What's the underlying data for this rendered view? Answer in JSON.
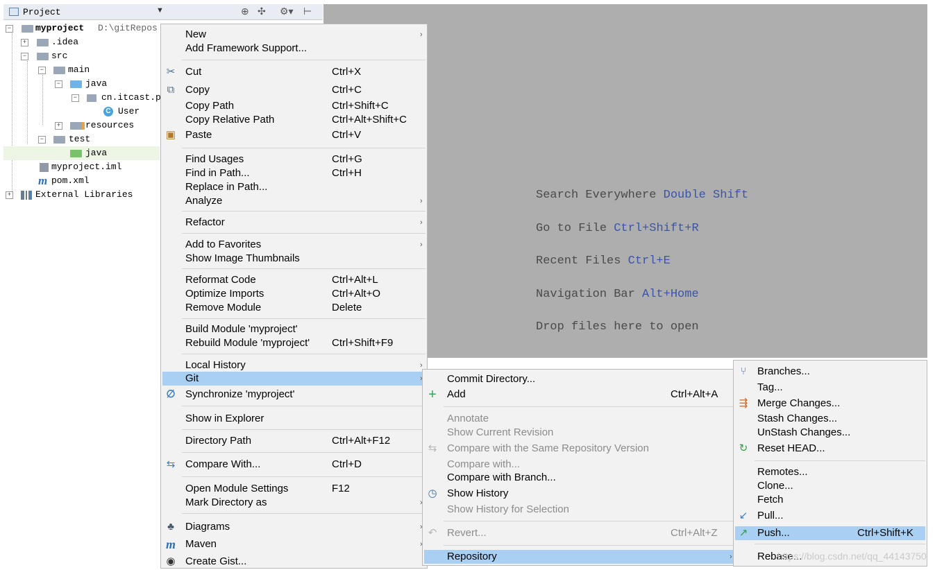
{
  "project_panel": {
    "title": "Project",
    "tree": [
      {
        "label": "myproject",
        "path": "D:\\gitRepos"
      },
      {
        "label": ".idea"
      },
      {
        "label": "src"
      },
      {
        "label": "main"
      },
      {
        "label": "java"
      },
      {
        "label": "cn.itcast.p"
      },
      {
        "label": "User"
      },
      {
        "label": "resources"
      },
      {
        "label": "test"
      },
      {
        "label": "java"
      },
      {
        "label": "myproject.iml"
      },
      {
        "label": "pom.xml"
      },
      {
        "label": "External Libraries"
      }
    ]
  },
  "editor_hints": [
    {
      "text": "Search Everywhere",
      "key": "Double Shift"
    },
    {
      "text": "Go to File",
      "key": "Ctrl+Shift+R"
    },
    {
      "text": "Recent Files",
      "key": "Ctrl+E"
    },
    {
      "text": "Navigation Bar",
      "key": "Alt+Home"
    },
    {
      "text": "Drop files here to open",
      "key": ""
    }
  ],
  "context_menu": {
    "items": [
      {
        "label": "New",
        "shortcut": ""
      },
      {
        "label": "Add Framework Support...",
        "shortcut": ""
      },
      {
        "label": "Cut",
        "shortcut": "Ctrl+X"
      },
      {
        "label": "Copy",
        "shortcut": "Ctrl+C"
      },
      {
        "label": "Copy Path",
        "shortcut": "Ctrl+Shift+C"
      },
      {
        "label": "Copy Relative Path",
        "shortcut": "Ctrl+Alt+Shift+C"
      },
      {
        "label": "Paste",
        "shortcut": "Ctrl+V"
      },
      {
        "label": "Find Usages",
        "shortcut": "Ctrl+G"
      },
      {
        "label": "Find in Path...",
        "shortcut": "Ctrl+H"
      },
      {
        "label": "Replace in Path...",
        "shortcut": ""
      },
      {
        "label": "Analyze",
        "shortcut": ""
      },
      {
        "label": "Refactor",
        "shortcut": ""
      },
      {
        "label": "Add to Favorites",
        "shortcut": ""
      },
      {
        "label": "Show Image Thumbnails",
        "shortcut": ""
      },
      {
        "label": "Reformat Code",
        "shortcut": "Ctrl+Alt+L"
      },
      {
        "label": "Optimize Imports",
        "shortcut": "Ctrl+Alt+O"
      },
      {
        "label": "Remove Module",
        "shortcut": "Delete"
      },
      {
        "label": "Build Module 'myproject'",
        "shortcut": ""
      },
      {
        "label": "Rebuild Module 'myproject'",
        "shortcut": "Ctrl+Shift+F9"
      },
      {
        "label": "Local History",
        "shortcut": ""
      },
      {
        "label": "Git",
        "shortcut": ""
      },
      {
        "label": "Synchronize 'myproject'",
        "shortcut": ""
      },
      {
        "label": "Show in Explorer",
        "shortcut": ""
      },
      {
        "label": "Directory Path",
        "shortcut": "Ctrl+Alt+F12"
      },
      {
        "label": "Compare With...",
        "shortcut": "Ctrl+D"
      },
      {
        "label": "Open Module Settings",
        "shortcut": "F12"
      },
      {
        "label": "Mark Directory as",
        "shortcut": ""
      },
      {
        "label": "Diagrams",
        "shortcut": ""
      },
      {
        "label": "Maven",
        "shortcut": ""
      },
      {
        "label": "Create Gist...",
        "shortcut": ""
      }
    ]
  },
  "git_menu": {
    "items": [
      {
        "label": "Commit Directory...",
        "shortcut": ""
      },
      {
        "label": "Add",
        "shortcut": "Ctrl+Alt+A"
      },
      {
        "label": "Annotate",
        "shortcut": ""
      },
      {
        "label": "Show Current Revision",
        "shortcut": ""
      },
      {
        "label": "Compare with the Same Repository Version",
        "shortcut": ""
      },
      {
        "label": "Compare with...",
        "shortcut": ""
      },
      {
        "label": "Compare with Branch...",
        "shortcut": ""
      },
      {
        "label": "Show History",
        "shortcut": ""
      },
      {
        "label": "Show History for Selection",
        "shortcut": ""
      },
      {
        "label": "Revert...",
        "shortcut": "Ctrl+Alt+Z"
      },
      {
        "label": "Repository",
        "shortcut": ""
      }
    ]
  },
  "repository_menu": {
    "items": [
      {
        "label": "Branches...",
        "shortcut": ""
      },
      {
        "label": "Tag...",
        "shortcut": ""
      },
      {
        "label": "Merge Changes...",
        "shortcut": ""
      },
      {
        "label": "Stash Changes...",
        "shortcut": ""
      },
      {
        "label": "UnStash Changes...",
        "shortcut": ""
      },
      {
        "label": "Reset HEAD...",
        "shortcut": ""
      },
      {
        "label": "Remotes...",
        "shortcut": ""
      },
      {
        "label": "Clone...",
        "shortcut": ""
      },
      {
        "label": "Fetch",
        "shortcut": ""
      },
      {
        "label": "Pull...",
        "shortcut": ""
      },
      {
        "label": "Push...",
        "shortcut": "Ctrl+Shift+K"
      },
      {
        "label": "Rebase...",
        "shortcut": ""
      }
    ]
  },
  "watermark": "https://blog.csdn.net/qq_44143750",
  "colors": {
    "highlight": "#a9d0f2",
    "editor_bg": "#aeaeae",
    "hint_key": "#3a55a8"
  }
}
